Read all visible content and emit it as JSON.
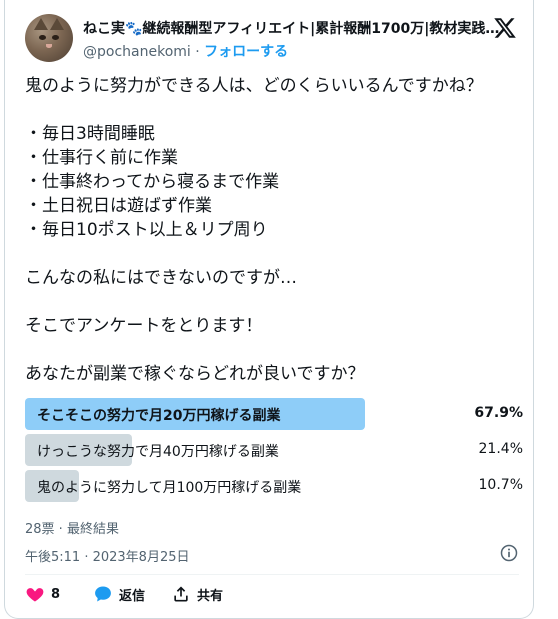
{
  "author": {
    "name": "ねこ実🐾継続報酬型アフィリエイト|累計報酬1700万|教材実践者...",
    "handle": "@pochanekomi",
    "separator": "·",
    "follow_label": "フォローする"
  },
  "tweet": {
    "text": "鬼のように努力ができる人は、どのくらいいるんですかね？\n\n・毎日3時間睡眠\n・仕事行く前に作業\n・仕事終わってから寝るまで作業\n・土日祝日は遊ばず作業\n・毎日10ポスト以上＆リプ周り\n\nこんなの私にはできないのですが…\n\nそこでアンケートをとります！\n\nあなたが副業で稼ぐならどれが良いですか？"
  },
  "poll": {
    "options": [
      {
        "label": "そこそこの努力で月20万円稼げる副業",
        "percent_text": "67.9%",
        "percent": 67.9,
        "winner": true
      },
      {
        "label": "けっこうな努力で月40万円稼げる副業",
        "percent_text": "21.4%",
        "percent": 21.4,
        "winner": false
      },
      {
        "label": "鬼のように努力して月100万円稼げる副業",
        "percent_text": "10.7%",
        "percent": 10.7,
        "winner": false
      }
    ],
    "meta": "28票 · 最終結果"
  },
  "timestamp": "午後5:11 · 2023年8月25日",
  "actions": {
    "like_count": "8",
    "reply_label": "返信",
    "share_label": "共有"
  },
  "colors": {
    "accent": "#1d9bf0",
    "poll_winner": "#8ecdf8",
    "poll_other": "#cfd9de",
    "like": "#f91880"
  }
}
